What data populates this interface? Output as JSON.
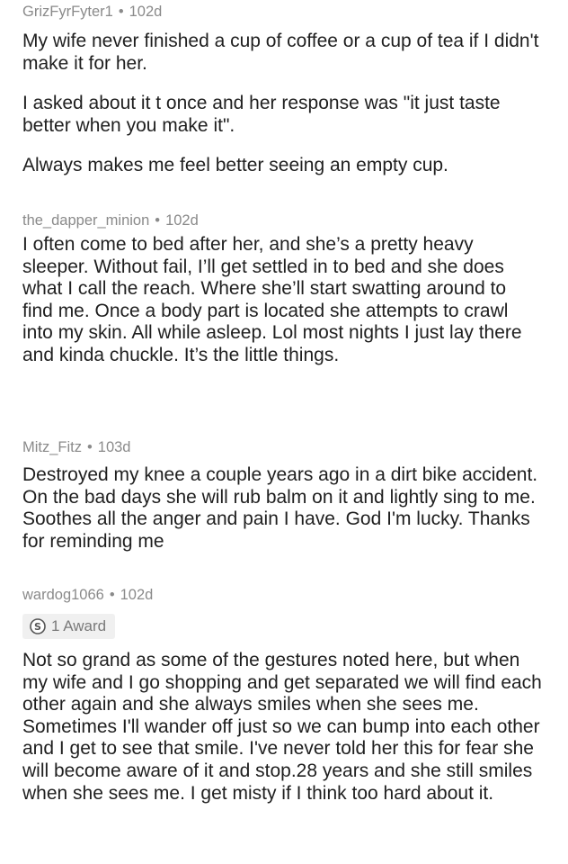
{
  "comments": [
    {
      "username": "GrizFyrFyter1",
      "separator": "•",
      "age": "102d",
      "paragraphs": [
        "My wife never finished a cup of coffee or a cup of tea if I didn't make it for her.",
        "I asked about it t once and her response was \"it just taste better when you make it\".",
        "Always makes me feel better seeing an empty cup."
      ]
    },
    {
      "username": "the_dapper_minion",
      "separator": "•",
      "age": "102d",
      "paragraphs": [
        "I often come to bed after her, and she’s a pretty heavy sleeper. Without fail, I’ll get settled in to bed and she does what I call the reach. Where she’ll start swatting around to find me. Once a body part is located she attempts to crawl into my skin. All while asleep. Lol most nights I just lay there and kinda chuckle. It’s the little things."
      ]
    },
    {
      "username": "Mitz_Fitz",
      "separator": "•",
      "age": "103d",
      "paragraphs": [
        "Destroyed my knee a couple years ago in a dirt bike accident. On the bad days she will rub balm on it and lightly sing to me. Soothes all the anger and pain I have. God I'm lucky. Thanks for reminding me"
      ]
    },
    {
      "username": "wardog1066",
      "separator": "•",
      "age": "102d",
      "award": {
        "label": "1 Award",
        "icon": "silver-award-icon"
      },
      "paragraphs": [
        "Not so grand as some of the gestures noted here, but when my wife and I go shopping and get separated we will find each other again and she always smiles when she sees me. Sometimes I'll wander off just so we can bump into each other and I get to see that smile. I've never told her this for fear she will become aware of it and stop.28 years and she still smiles when she sees me. I get misty if I think too hard about it."
      ]
    }
  ]
}
